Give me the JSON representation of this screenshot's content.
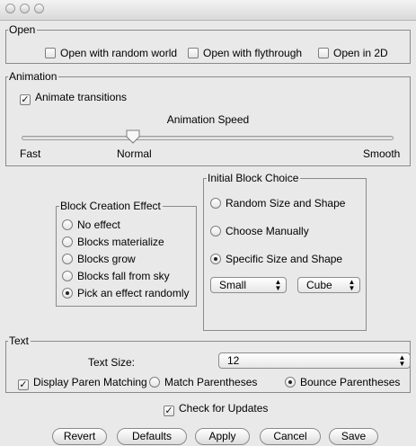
{
  "open": {
    "legend": "Open",
    "random_world": "Open with random world",
    "flythrough": "Open with flythrough",
    "in_2d": "Open in 2D"
  },
  "animation": {
    "legend": "Animation",
    "animate_transitions": "Animate transitions",
    "animate_transitions_checked": true,
    "speed_label": "Animation Speed",
    "fast_label": "Fast",
    "normal_label": "Normal",
    "smooth_label": "Smooth",
    "speed_position": 0.3
  },
  "block_creation": {
    "legend": "Block Creation Effect",
    "options": [
      {
        "label": "No effect",
        "selected": false
      },
      {
        "label": "Blocks materialize",
        "selected": false
      },
      {
        "label": "Blocks grow",
        "selected": false
      },
      {
        "label": "Blocks fall from sky",
        "selected": false
      },
      {
        "label": "Pick an effect randomly",
        "selected": true
      }
    ]
  },
  "initial_block": {
    "legend": "Initial Block Choice",
    "options": [
      {
        "label": "Random Size and Shape",
        "selected": false
      },
      {
        "label": "Choose Manually",
        "selected": false
      },
      {
        "label": "Specific Size and Shape",
        "selected": true
      }
    ],
    "size_value": "Small",
    "shape_value": "Cube"
  },
  "text": {
    "legend": "Text",
    "size_label": "Text Size:",
    "size_value": "12",
    "paren_matching": "Display Paren Matching",
    "paren_matching_checked": true,
    "match_parens": "Match Parentheses",
    "bounce_parens": "Bounce Parentheses",
    "bounce_selected": true
  },
  "updates": {
    "label": "Check for Updates",
    "checked": true
  },
  "buttons": {
    "revert": "Revert",
    "defaults": "Defaults",
    "apply": "Apply",
    "cancel": "Cancel",
    "save": "Save"
  }
}
